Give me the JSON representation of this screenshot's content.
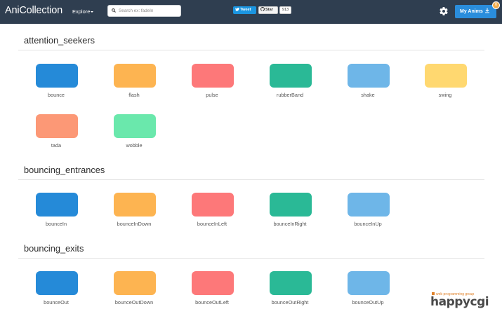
{
  "header": {
    "brand": "AniCollection",
    "explore_label": "Explore",
    "search_placeholder": "Search ex: fadeIn",
    "tweet_label": "Tweet",
    "star_label": "Star",
    "star_count": "913",
    "settings_icon": "gear-icon",
    "my_anims_label": "My Anims",
    "my_anims_badge": "0"
  },
  "colors": {
    "navbar": "#2f3e50",
    "blue": "#258ad8",
    "orange": "#fdb451",
    "red": "#fd7879",
    "teal": "#2ab996",
    "light_blue": "#6eb6e8",
    "yellow": "#ffd870",
    "salmon": "#fc9876",
    "green": "#6ae8ac"
  },
  "sections": [
    {
      "title": "attention_seekers",
      "items": [
        "bounce",
        "flash",
        "pulse",
        "rubberBand",
        "shake",
        "swing",
        "tada",
        "wobble"
      ]
    },
    {
      "title": "bouncing_entrances",
      "items": [
        "bounceIn",
        "bounceInDown",
        "bounceInLeft",
        "bounceInRight",
        "bounceInUp"
      ]
    },
    {
      "title": "bouncing_exits",
      "items": [
        "bounceOut",
        "bounceOutDown",
        "bounceOutLeft",
        "bounceOutRight",
        "bounceOutUp"
      ]
    }
  ],
  "watermark": {
    "tagline": "web programming group",
    "name": "happycgi"
  }
}
